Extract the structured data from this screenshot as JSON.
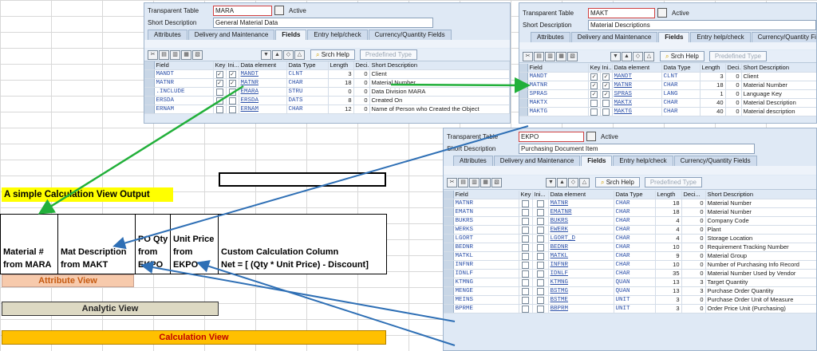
{
  "mara": {
    "table_label": "Transparent Table",
    "table_name": "MARA",
    "status": "Active",
    "desc_label": "Short Description",
    "desc": "General Material Data",
    "tabs": [
      "Attributes",
      "Delivery and Maintenance",
      "Fields",
      "Entry help/check",
      "Currency/Quantity Fields"
    ],
    "srch_help": "Srch Help",
    "predef": "Predefined Type",
    "headers": [
      "Field",
      "Key",
      "Ini...",
      "Data element",
      "Data Type",
      "Length",
      "Deci...",
      "Short Description"
    ],
    "rows": [
      [
        "MANDT",
        "on",
        "on",
        "MANDT",
        "CLNT",
        "3",
        "0",
        "Client"
      ],
      [
        "MATNR",
        "on",
        "on",
        "MATNR",
        "CHAR",
        "18",
        "0",
        "Material Number"
      ],
      [
        ".INCLUDE",
        "off",
        "off",
        "EMARA",
        "STRU",
        "0",
        "0",
        "Data Division MARA"
      ],
      [
        "ERSDA",
        "off",
        "off",
        "ERSDA",
        "DATS",
        "8",
        "0",
        "Created On"
      ],
      [
        "ERNAM",
        "off",
        "off",
        "ERNAM",
        "CHAR",
        "12",
        "0",
        "Name of Person who Created the Object"
      ]
    ]
  },
  "makt": {
    "table_label": "Transparent Table",
    "table_name": "MAKT",
    "status": "Active",
    "desc_label": "Short Description",
    "desc": "Material Descriptions",
    "tabs": [
      "Attributes",
      "Delivery and Maintenance",
      "Fields",
      "Entry help/check",
      "Currency/Quantity Fields"
    ],
    "srch_help": "Srch Help",
    "predef": "Predefined Type",
    "headers": [
      "Field",
      "Key",
      "Ini...",
      "Data element",
      "Data Type",
      "Length",
      "Deci...",
      "Short Description"
    ],
    "rows": [
      [
        "MANDT",
        "on",
        "on",
        "MANDT",
        "CLNT",
        "3",
        "0",
        "Client"
      ],
      [
        "MATNR",
        "on",
        "on",
        "MATNR",
        "CHAR",
        "18",
        "0",
        "Material Number"
      ],
      [
        "SPRAS",
        "on",
        "on",
        "SPRAS",
        "LANG",
        "1",
        "0",
        "Language Key"
      ],
      [
        "MAKTX",
        "off",
        "off",
        "MAKTX",
        "CHAR",
        "40",
        "0",
        "Material Description"
      ],
      [
        "MAKTG",
        "off",
        "off",
        "MAKTG",
        "CHAR",
        "40",
        "0",
        "Material description"
      ]
    ]
  },
  "ekpo": {
    "table_label": "Transparent Table",
    "table_name": "EKPO",
    "status": "Active",
    "desc_label": "Short Description",
    "desc": "Purchasing Document Item",
    "tabs": [
      "Attributes",
      "Delivery and Maintenance",
      "Fields",
      "Entry help/check",
      "Currency/Quantity Fields"
    ],
    "srch_help": "Srch Help",
    "predef": "Predefined Type",
    "headers": [
      "Field",
      "Key",
      "Ini...",
      "Data element",
      "Data Type",
      "Length",
      "Deci...",
      "Short Description"
    ],
    "rows": [
      [
        "MATNR",
        "off",
        "off",
        "MATNR",
        "CHAR",
        "18",
        "0",
        "Material Number"
      ],
      [
        "EMATN",
        "off",
        "off",
        "EMATNR",
        "CHAR",
        "18",
        "0",
        "Material Number"
      ],
      [
        "BUKRS",
        "off",
        "off",
        "BUKRS",
        "CHAR",
        "4",
        "0",
        "Company Code"
      ],
      [
        "WERKS",
        "off",
        "off",
        "EWERK",
        "CHAR",
        "4",
        "0",
        "Plant"
      ],
      [
        "LGORT",
        "off",
        "off",
        "LGORT_D",
        "CHAR",
        "4",
        "0",
        "Storage Location"
      ],
      [
        "BEDNR",
        "off",
        "off",
        "BEDNR",
        "CHAR",
        "10",
        "0",
        "Requirement Tracking Number"
      ],
      [
        "MATKL",
        "off",
        "off",
        "MATKL",
        "CHAR",
        "9",
        "0",
        "Material Group"
      ],
      [
        "INFNR",
        "off",
        "off",
        "INFNR",
        "CHAR",
        "10",
        "0",
        "Number of Purchasing Info Record"
      ],
      [
        "IDNLF",
        "off",
        "off",
        "IDNLF",
        "CHAR",
        "35",
        "0",
        "Material Number Used by Vendor"
      ],
      [
        "KTMNG",
        "off",
        "off",
        "KTMNG",
        "QUAN",
        "13",
        "3",
        "Target Quantity"
      ],
      [
        "MENGE",
        "off",
        "off",
        "BSTMG",
        "QUAN",
        "13",
        "3",
        "Purchase Order Quantity"
      ],
      [
        "MEINS",
        "off",
        "off",
        "BSTME",
        "UNIT",
        "3",
        "0",
        "Purchase Order Unit of Measure"
      ],
      [
        "BPRME",
        "off",
        "off",
        "BBPRM",
        "UNIT",
        "3",
        "0",
        "Order Price Unit (Purchasing)"
      ]
    ]
  },
  "output": {
    "title": "A simple Calculation View Output",
    "col1": [
      "Material #",
      "from MARA"
    ],
    "col2": [
      "Mat Description",
      "from MAKT"
    ],
    "col3": [
      "PO Qty",
      "from",
      "EKPO"
    ],
    "col4": [
      "Unit Price",
      "from",
      "EKPO"
    ],
    "col5": [
      "Custom Calculation Column",
      "Net = [ (Qty * Unit Price) - Discount]"
    ],
    "attribute_view": "Attribute View",
    "analytic_view": "Analytic View",
    "calculation_view": "Calculation View"
  },
  "colors": {
    "green_arrow": "#22b03a",
    "blue_arrow": "#2e6fb5",
    "title_bg": "#ffff00",
    "attr_bg": "#f7caac",
    "analytic_bg": "#ddd9c3",
    "calc_bg": "#ffc000",
    "calc_text": "#c00000",
    "attr_text": "#c55a11"
  }
}
